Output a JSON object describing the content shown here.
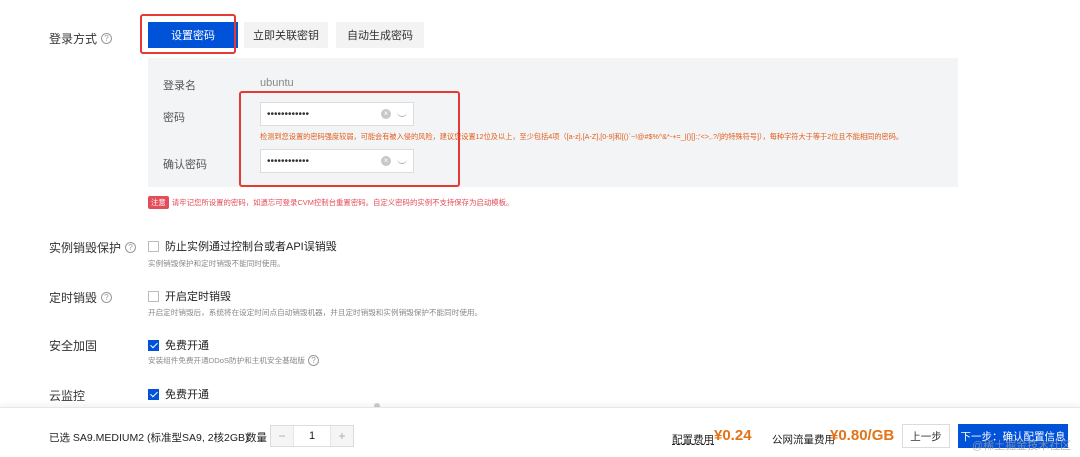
{
  "login": {
    "label": "登录方式",
    "tabs": [
      "设置密码",
      "立即关联密钥",
      "自动生成密码"
    ],
    "username_label": "登录名",
    "username_value": "ubuntu",
    "password_label": "密码",
    "password_value": "••••••••••••",
    "confirm_label": "确认密码",
    "confirm_value": "••••••••••••",
    "warning": "检测到您设置的密码强度较弱，可能会有被入侵的风险，建议您设置12位及以上，至少包括4项（[a-z],[A-Z],[0-9]和[()`~!@#$%^&*-+=_|{}[]:;'<>,.?/]的特殊符号]），每种字符大于等于2位且不能相同的密码。",
    "notice_badge": "注意",
    "notice_text": "请牢记您所设置的密码，如遗忘可登录CVM控制台重置密码。自定义密码的实例不支持保存为启动模板。"
  },
  "destroy_protect": {
    "label": "实例销毁保护",
    "checkbox_label": "防止实例通过控制台或者API误销毁",
    "checked": false,
    "desc": "实例销毁保护和定时销毁不能同时使用。"
  },
  "timed_destroy": {
    "label": "定时销毁",
    "checkbox_label": "开启定时销毁",
    "checked": false,
    "desc": "开启定时销毁后，系统将在设定时间点自动销毁机器，并且定时销毁和实例销毁保护不能同时使用。"
  },
  "security": {
    "label": "安全加固",
    "checkbox_label": "免费开通",
    "checked": true,
    "desc": "安装组件免费开通DDoS防护和主机安全基础版"
  },
  "monitor": {
    "label": "云监控",
    "checkbox_label": "免费开通",
    "checked": true
  },
  "footer": {
    "selected": "已选   SA9.MEDIUM2 (标准型SA9, 2核2GB)",
    "qty_label": "数量",
    "qty_minus": "−",
    "qty_value": "1",
    "qty_plus": "+",
    "config_fee_label": "配置费用",
    "config_fee_value": "¥0.24",
    "traffic_fee_label": "公网流量费用",
    "traffic_fee_value": "¥0.80/GB",
    "prev_label": "上一步",
    "next_label": "下一步：确认配置信息"
  },
  "watermark": "@稀土掘金技术社区",
  "colors": {
    "primary": "#0052d9",
    "price": "#e37318",
    "warning": "#e35d19",
    "danger": "#e34d59",
    "highlight_box": "#e53935"
  }
}
